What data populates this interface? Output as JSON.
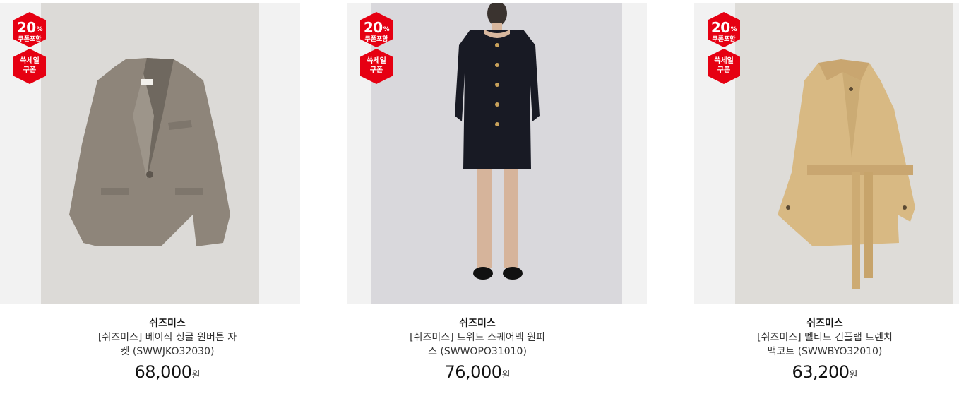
{
  "products": [
    {
      "badge_percent": "20",
      "badge_percent_sign": "%",
      "badge_percent_caption": "쿠폰포함",
      "badge_coupon_line1": "쓱세일",
      "badge_coupon_line2": "쿠폰",
      "brand": "쉬즈미스",
      "name": "[쉬즈미스] 베이직 싱글 원버튼 자켓 (SWWJKO32030)",
      "price": "68,000",
      "currency": "원",
      "image": "beige-single-button-jacket"
    },
    {
      "badge_percent": "20",
      "badge_percent_sign": "%",
      "badge_percent_caption": "쿠폰포함",
      "badge_coupon_line1": "쓱세일",
      "badge_coupon_line2": "쿠폰",
      "brand": "쉬즈미스",
      "name": "[쉬즈미스] 트위드 스퀘어넥 원피스 (SWWOPO31010)",
      "price": "76,000",
      "currency": "원",
      "image": "black-tweed-dress"
    },
    {
      "badge_percent": "20",
      "badge_percent_sign": "%",
      "badge_percent_caption": "쿠폰포함",
      "badge_coupon_line1": "쓱세일",
      "badge_coupon_line2": "쿠폰",
      "brand": "쉬즈미스",
      "name": "[쉬즈미스] 벨티드 건플랩 트렌치 맥코트 (SWWBYO32010)",
      "price": "63,200",
      "currency": "원",
      "image": "beige-belted-trench-coat"
    }
  ],
  "colors": {
    "badge_red": "#e60012",
    "photo_bg": "#dedcd9"
  }
}
